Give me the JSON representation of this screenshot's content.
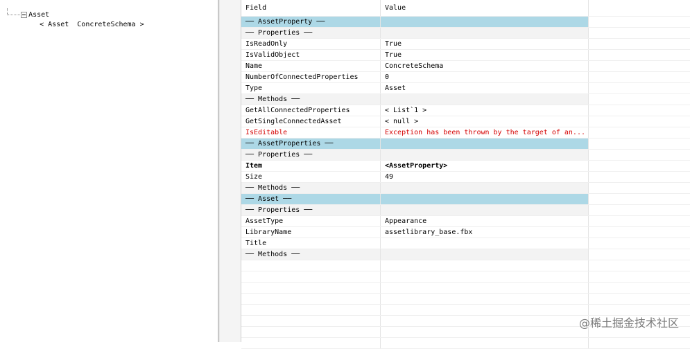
{
  "tree": {
    "root_label": "Asset",
    "child_label": "< Asset  ConcreteSchema >"
  },
  "grid": {
    "headers": {
      "field": "Field",
      "value": "Value"
    },
    "rows": [
      {
        "kind": "section",
        "field": "── AssetProperty ──",
        "value": ""
      },
      {
        "kind": "subsection",
        "field": "  ── Properties ──",
        "value": ""
      },
      {
        "kind": "data",
        "field": "IsReadOnly",
        "value": "True"
      },
      {
        "kind": "data",
        "field": "IsValidObject",
        "value": "True"
      },
      {
        "kind": "data",
        "field": "Name",
        "value": "ConcreteSchema"
      },
      {
        "kind": "data",
        "field": "NumberOfConnectedProperties",
        "value": "0"
      },
      {
        "kind": "data",
        "field": "Type",
        "value": "Asset"
      },
      {
        "kind": "subsection",
        "field": "  ── Methods ──",
        "value": ""
      },
      {
        "kind": "data",
        "field": "GetAllConnectedProperties",
        "value": "< List`1 >"
      },
      {
        "kind": "data",
        "field": "GetSingleConnectedAsset",
        "value": "< null >"
      },
      {
        "kind": "error",
        "field": "IsEditable",
        "value": "Exception has been thrown by the target of an..."
      },
      {
        "kind": "section",
        "field": "── AssetProperties ──",
        "value": ""
      },
      {
        "kind": "subsection",
        "field": "  ── Properties ──",
        "value": ""
      },
      {
        "kind": "bold",
        "field": "Item",
        "value": "<AssetProperty>"
      },
      {
        "kind": "data",
        "field": "Size",
        "value": "49"
      },
      {
        "kind": "subsection",
        "field": "  ── Methods ──",
        "value": ""
      },
      {
        "kind": "section",
        "field": "── Asset ──",
        "value": ""
      },
      {
        "kind": "subsection",
        "field": "  ── Properties ──",
        "value": ""
      },
      {
        "kind": "data",
        "field": "AssetType",
        "value": "Appearance"
      },
      {
        "kind": "data",
        "field": "LibraryName",
        "value": "assetlibrary_base.fbx"
      },
      {
        "kind": "data",
        "field": "Title",
        "value": ""
      },
      {
        "kind": "subsection",
        "field": "  ── Methods ──",
        "value": ""
      }
    ],
    "empty_rows": 8
  },
  "watermark": "@稀土掘金技术社区",
  "colors": {
    "section_bg": "#add8e6",
    "subsection_bg": "#f3f3f3",
    "error_text": "#d40000"
  },
  "icons": {
    "tree_expander": "minus-box-icon"
  }
}
